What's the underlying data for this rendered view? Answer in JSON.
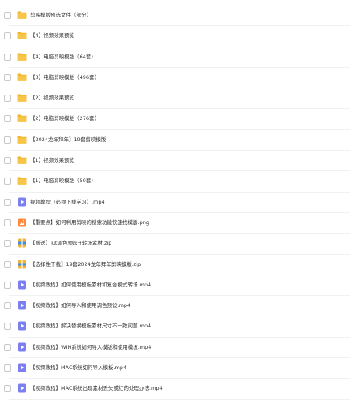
{
  "colors": {
    "folder": "#f7c548",
    "folder_tab": "#f0b429",
    "video": "#7b7ff0",
    "image": "#ff8a3d",
    "archive": "#f2b233",
    "archive_accent": "#4a90e2",
    "text": "#333333",
    "divider": "#f0f0f0"
  },
  "files": [
    {
      "name": "剪映模版预选文件（部分）",
      "icon": "folder-icon"
    },
    {
      "name": "【4】视频效果预览",
      "icon": "folder-icon"
    },
    {
      "name": "【4】电脑剪映模版（64套）",
      "icon": "folder-icon"
    },
    {
      "name": "【3】电脑剪映模版（496套）",
      "icon": "folder-icon"
    },
    {
      "name": "【2】视频效果预览",
      "icon": "folder-icon"
    },
    {
      "name": "【2】电脑剪映模版（276套）",
      "icon": "folder-icon"
    },
    {
      "name": "【2024龙年拜年】19套剪映模版",
      "icon": "folder-icon"
    },
    {
      "name": "【1】视频效果预览",
      "icon": "folder-icon"
    },
    {
      "name": "【1】电脑剪映模版（59套）",
      "icon": "folder-icon"
    },
    {
      "name": "视频教程（必须下载学习）.mp4",
      "icon": "video-file-icon"
    },
    {
      "name": "【重要点】如何利用剪映的搜索功能快速找模版.png",
      "icon": "image-file-icon"
    },
    {
      "name": "【赠送】lut调色预设+转场素材.zip",
      "icon": "archive-file-icon"
    },
    {
      "name": "【选择性下载】19套2024龙年拜年剪映模版.zip",
      "icon": "archive-file-icon"
    },
    {
      "name": "【视频教程】如何使用模板素材和复合模式转场.mp4",
      "icon": "video-file-icon"
    },
    {
      "name": "【视频教程】如何导入和使用调色预设.mp4",
      "icon": "video-file-icon"
    },
    {
      "name": "【视频教程】解决替换模板素材尺寸不一致问题.mp4",
      "icon": "video-file-icon"
    },
    {
      "name": "【视频教程】WIN系统如何导入模版和使用模板.mp4",
      "icon": "video-file-icon"
    },
    {
      "name": "【视频教程】MAC系统如何导入模板.mp4",
      "icon": "video-file-icon"
    },
    {
      "name": "【视频教程】MAC系统出现素材丢失或红的处理办法.mp4",
      "icon": "video-file-icon"
    }
  ]
}
